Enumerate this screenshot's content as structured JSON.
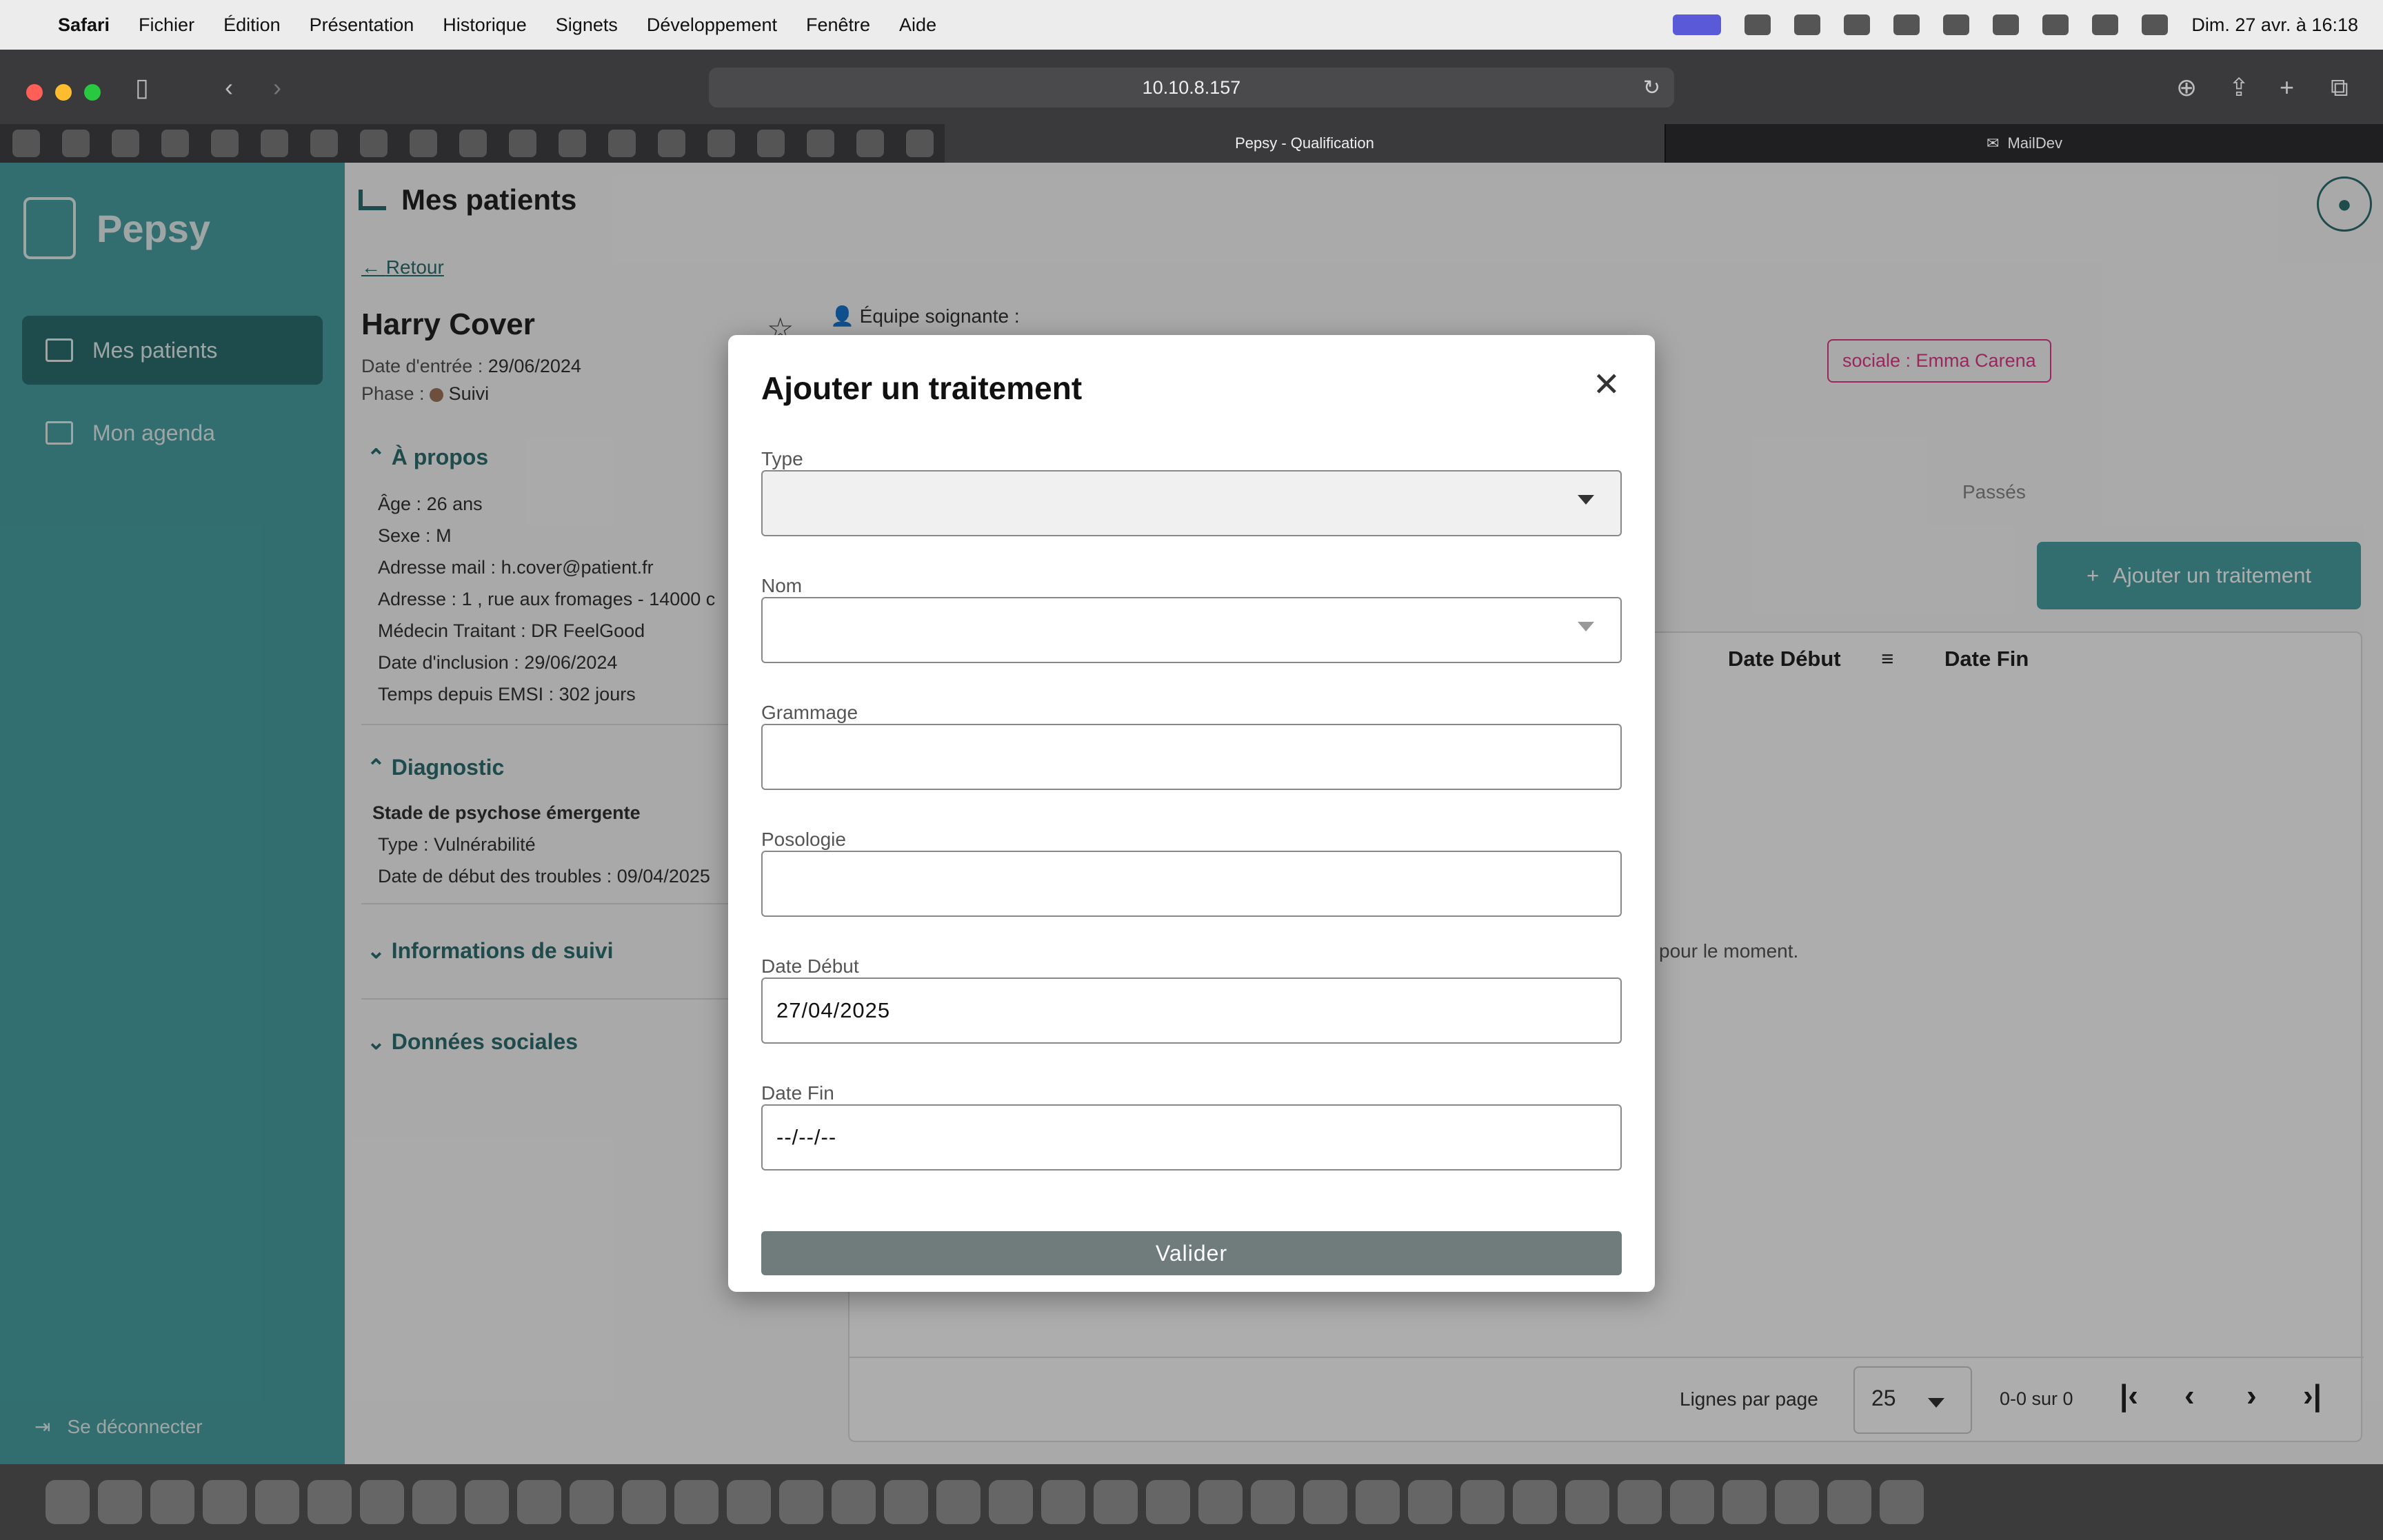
{
  "menubar": {
    "app": "Safari",
    "items": [
      "Fichier",
      "Édition",
      "Présentation",
      "Historique",
      "Signets",
      "Développement",
      "Fenêtre",
      "Aide"
    ],
    "clock": "Dim. 27 avr. à 16:18"
  },
  "browser": {
    "url": "10.10.8.157",
    "tab_active": "Pepsy - Qualification",
    "tab_other": "MailDev"
  },
  "sidebar": {
    "brand": "Pepsy",
    "items": [
      {
        "label": "Mes patients"
      },
      {
        "label": "Mon agenda"
      }
    ],
    "logout": "Se déconnecter"
  },
  "page": {
    "title": "Mes patients",
    "back": "Retour"
  },
  "patient": {
    "name": "Harry Cover",
    "entry_label": "Date d'entrée :",
    "entry_value": "29/06/2024",
    "phase_label": "Phase :",
    "phase_value": "Suivi",
    "phase_color": "#a0765a",
    "team_label": "Équipe soignante :",
    "team_chip": "sociale : Emma Carena"
  },
  "about": {
    "title": "À propos",
    "fields": [
      {
        "label": "Âge :",
        "value": "26 ans"
      },
      {
        "label": "Sexe :",
        "value": "M"
      },
      {
        "label": "Adresse mail :",
        "value": "h.cover@patient.fr"
      },
      {
        "label": "Adresse :",
        "value": "1 , rue aux fromages - 14000 c"
      },
      {
        "label": "Médecin Traitant :",
        "value": "DR FeelGood"
      },
      {
        "label": "Date d'inclusion :",
        "value": "29/06/2024"
      },
      {
        "label": "Temps depuis EMSI :",
        "value": "302 jours"
      }
    ]
  },
  "diagnostic": {
    "title": "Diagnostic",
    "stage": "Stade de psychose émergente",
    "type_label": "Type :",
    "type_value": "Vulnérabilité",
    "start_label": "Date de début des troubles :",
    "start_value": "09/04/2025"
  },
  "sections": {
    "follow_up": "Informations de suivi",
    "social": "Données sociales"
  },
  "treatments": {
    "tab_past": "Passés",
    "add_button": "Ajouter un traitement",
    "columns": [
      "Date Début",
      "Date Fin"
    ],
    "empty_text": "pour le moment.",
    "rows_per_page_label": "Lignes par page",
    "rows_per_page": "25",
    "range": "0-0 sur 0"
  },
  "modal": {
    "title": "Ajouter un traitement",
    "type_label": "Type",
    "type_value": "",
    "name_label": "Nom",
    "name_value": "",
    "dosage_label": "Grammage",
    "dosage_value": "",
    "posology_label": "Posologie",
    "posology_value": "",
    "start_label": "Date Début",
    "start_value": "27/04/2025",
    "end_label": "Date Fin",
    "end_value": "--/--/--",
    "submit": "Valider"
  },
  "colors": {
    "teal": "#4aa3a5",
    "teal_dark": "#2d6f71",
    "chip": "#e23a8a"
  }
}
